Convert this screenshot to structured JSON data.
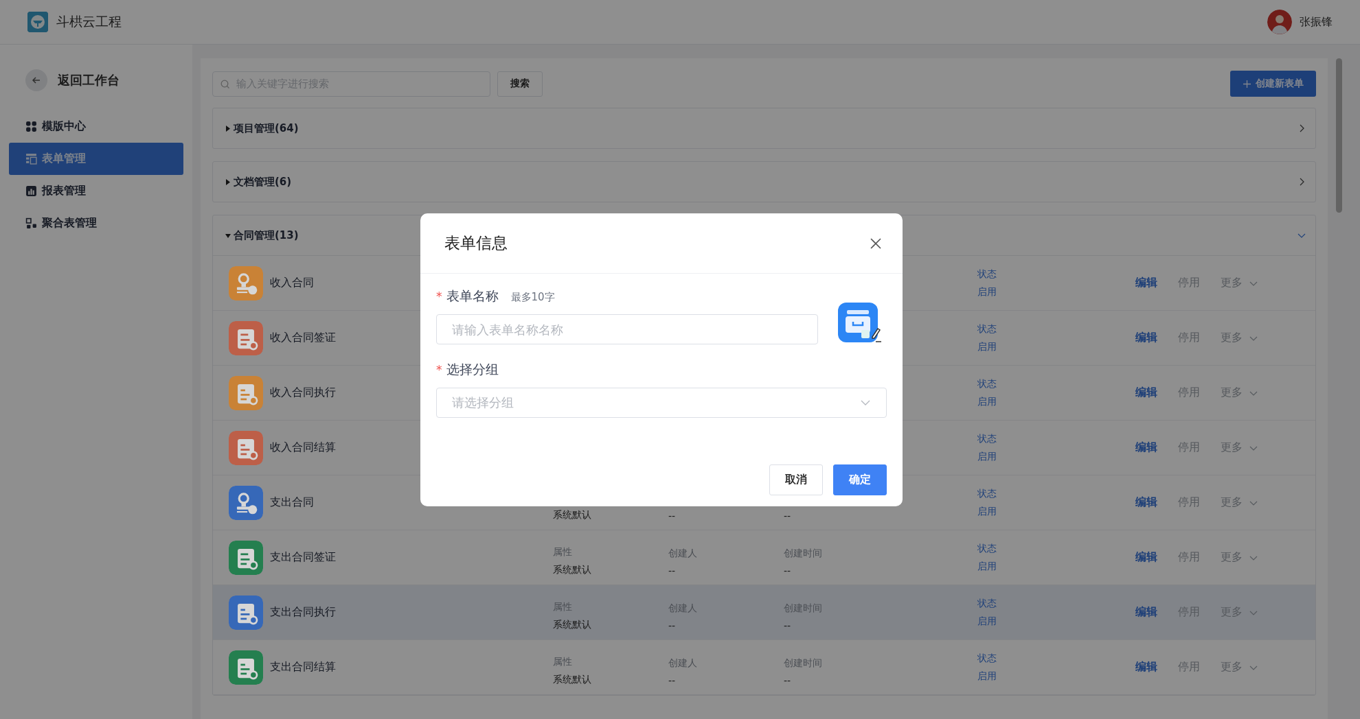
{
  "header": {
    "app_name": "斗栱云工程",
    "user_name": "张振锋"
  },
  "sidebar": {
    "back_label": "返回工作台",
    "items": [
      {
        "label": "模版中心",
        "selected": false
      },
      {
        "label": "表单管理",
        "selected": true
      },
      {
        "label": "报表管理",
        "selected": false
      },
      {
        "label": "聚合表管理",
        "selected": false
      }
    ]
  },
  "toolbar": {
    "search_placeholder": "输入关键字进行搜索",
    "search_button": "搜索",
    "create_button": "创建新表单"
  },
  "groups": [
    {
      "title": "项目管理(64)",
      "expanded": false
    },
    {
      "title": "文档管理(6)",
      "expanded": false
    },
    {
      "title": "合同管理(13)",
      "expanded": true,
      "rows": [
        {
          "name": "收入合同",
          "color": "#c98236",
          "hovered": false,
          "status_label": "状态",
          "status": "启用",
          "actions": [
            "编辑",
            "停用",
            "更多"
          ]
        },
        {
          "name": "收入合同签证",
          "color": "#bd5f48",
          "hovered": false,
          "status_label": "状态",
          "status": "启用",
          "actions": [
            "编辑",
            "停用",
            "更多"
          ]
        },
        {
          "name": "收入合同执行",
          "color": "#c98236",
          "hovered": false,
          "status_label": "状态",
          "status": "启用",
          "actions": [
            "编辑",
            "停用",
            "更多"
          ]
        },
        {
          "name": "收入合同结算",
          "color": "#bd5f48",
          "hovered": false,
          "status_label": "状态",
          "status": "启用",
          "actions": [
            "编辑",
            "停用",
            "更多"
          ]
        },
        {
          "name": "支出合同",
          "color": "#3668b8",
          "hovered": false,
          "attribute": "系统默认",
          "creator": "--",
          "created_at": "--",
          "status_label": "状态",
          "status": "启用",
          "actions": [
            "编辑",
            "停用",
            "更多"
          ]
        },
        {
          "name": "支出合同签证",
          "color": "#247f4f",
          "hovered": false,
          "attribute_label": "属性",
          "attribute": "系统默认",
          "creator_label": "创建人",
          "creator": "--",
          "created_at_label": "创建时间",
          "created_at": "--",
          "status_label": "状态",
          "status": "启用",
          "actions": [
            "编辑",
            "停用",
            "更多"
          ]
        },
        {
          "name": "支出合同执行",
          "color": "#3668b8",
          "hovered": true,
          "attribute_label": "属性",
          "attribute": "系统默认",
          "creator_label": "创建人",
          "creator": "--",
          "created_at_label": "创建时间",
          "created_at": "--",
          "status_label": "状态",
          "status": "启用",
          "actions": [
            "编辑",
            "停用",
            "更多"
          ]
        },
        {
          "name": "支出合同结算",
          "color": "#247f4f",
          "hovered": false,
          "attribute_label": "属性",
          "attribute": "系统默认",
          "creator_label": "创建人",
          "creator": "--",
          "created_at_label": "创建时间",
          "created_at": "--",
          "status_label": "状态",
          "status": "启用",
          "actions": [
            "编辑",
            "停用",
            "更多"
          ]
        }
      ]
    }
  ],
  "dialog": {
    "title": "表单信息",
    "fields": [
      {
        "kind": "text",
        "label": "表单名称",
        "hint": "最多10字",
        "placeholder": "请输入表单名称名称",
        "required_mark": "*"
      },
      {
        "kind": "select",
        "label": "选择分组",
        "placeholder": "请选择分组",
        "required_mark": "*"
      }
    ],
    "buttons": [
      {
        "label": "取消",
        "primary": false
      },
      {
        "label": "确定",
        "primary": true
      }
    ]
  }
}
